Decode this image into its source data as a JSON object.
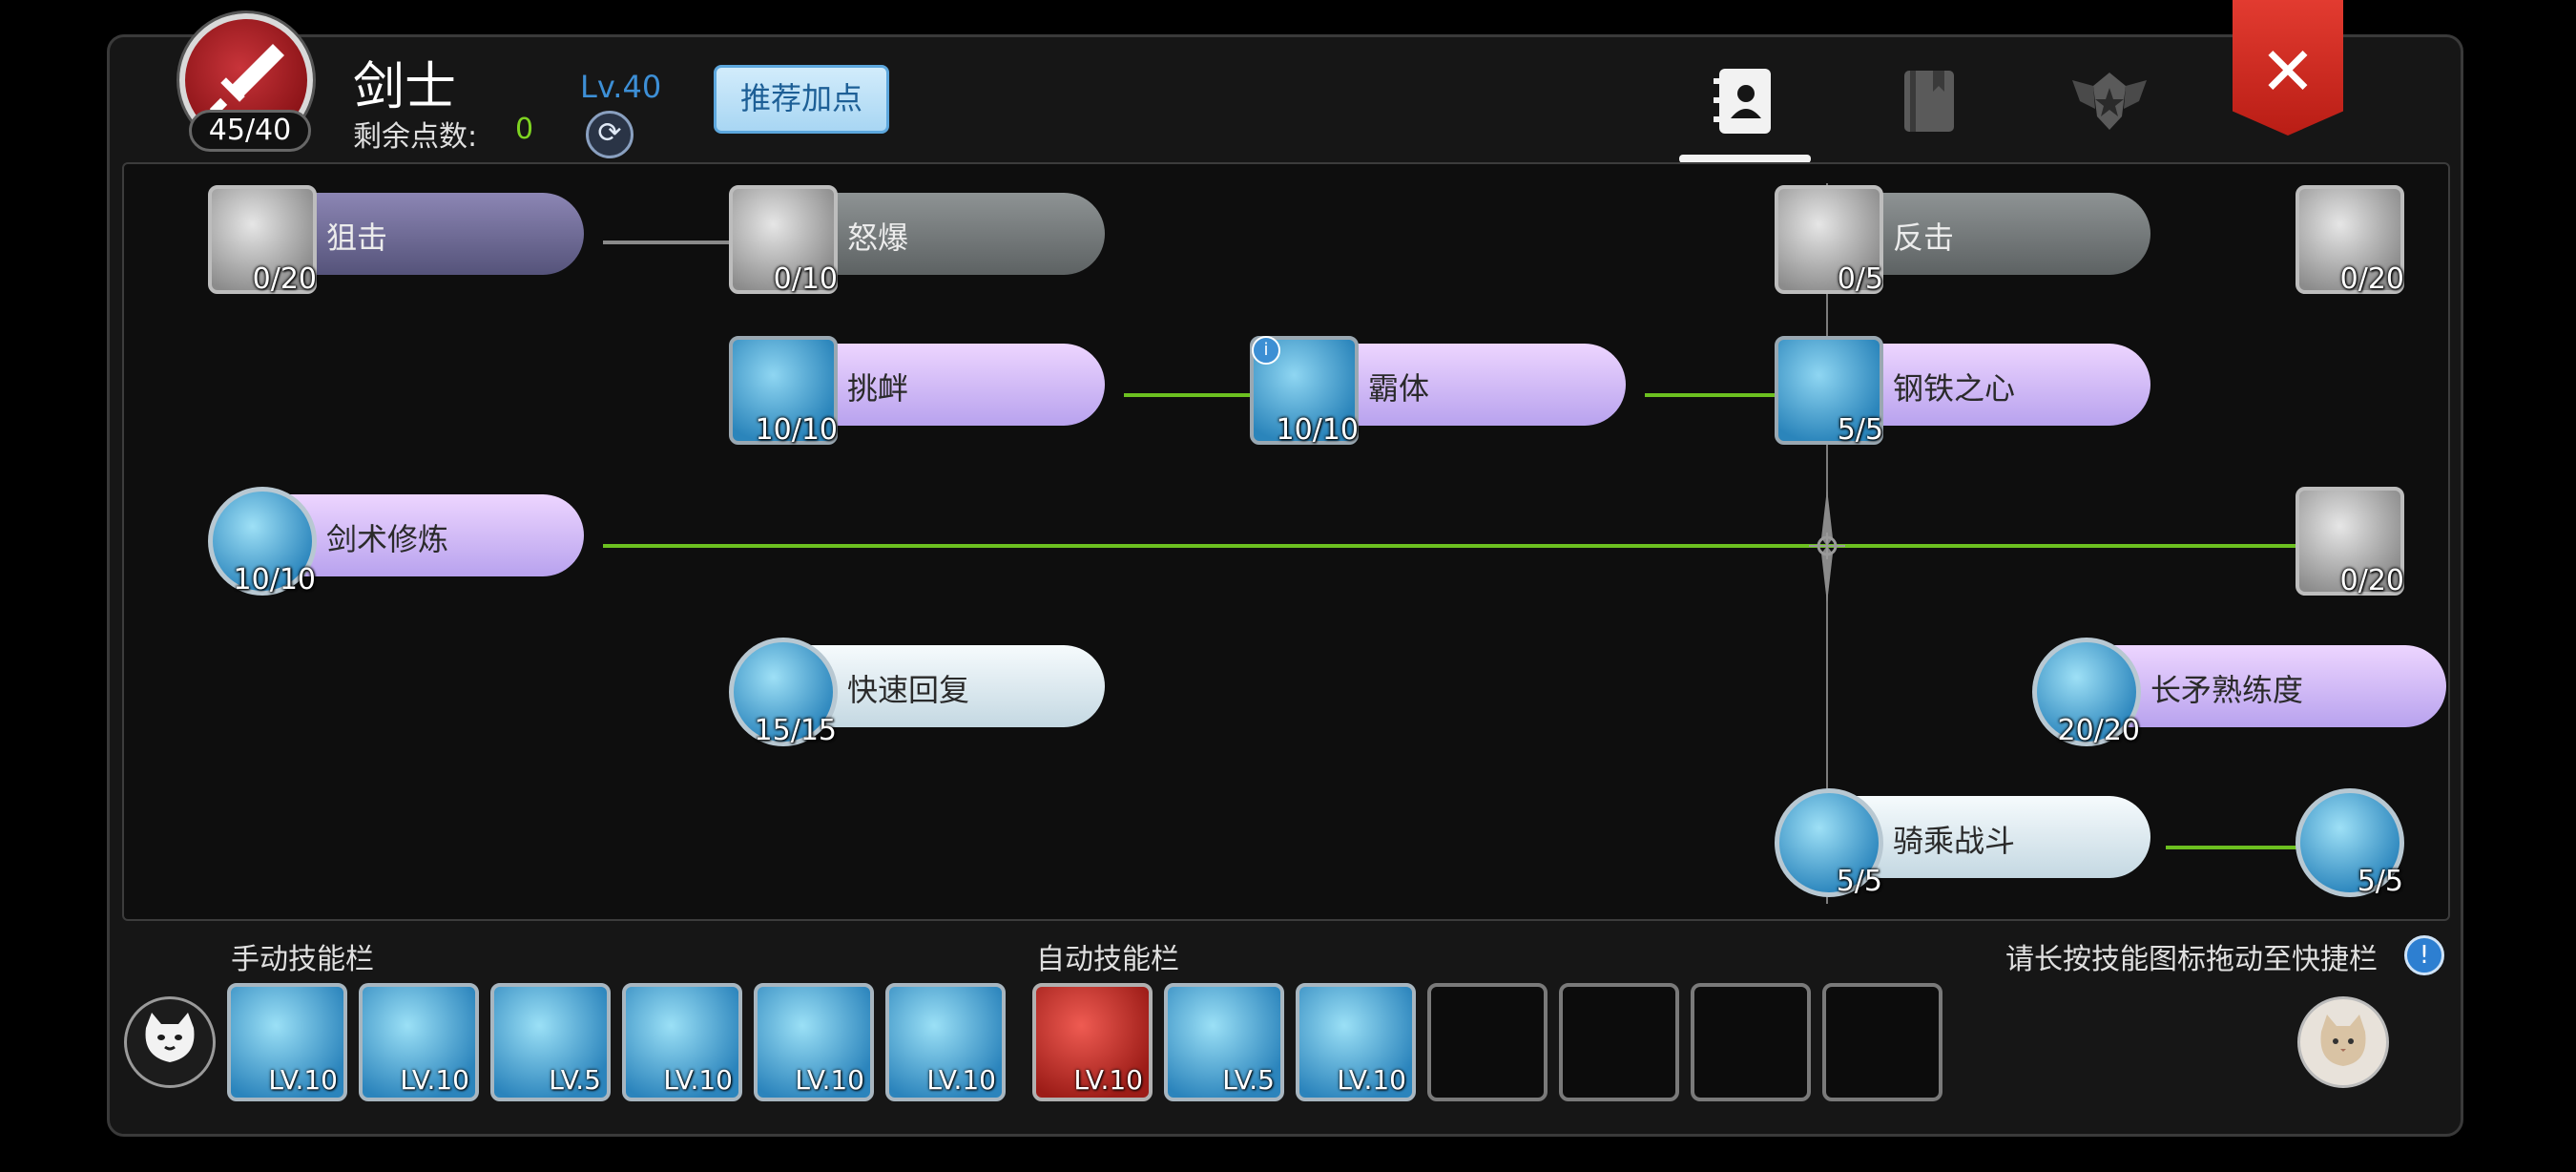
{
  "header": {
    "job_name": "剑士",
    "points_badge": "45/40",
    "remaining_label": "剩余点数:",
    "remaining_value": "0",
    "level": "Lv.40",
    "recommend_button": "推荐加点",
    "close_symbol": "✕"
  },
  "tabs": [
    {
      "icon": "contact-book-icon",
      "active": true
    },
    {
      "icon": "book-icon",
      "active": false
    },
    {
      "icon": "winged-emblem-icon",
      "active": false
    }
  ],
  "skills": [
    {
      "name": "狙击",
      "level": "0/20",
      "learned": false
    },
    {
      "name": "怒爆",
      "level": "0/10",
      "learned": false
    },
    {
      "name": "反击",
      "level": "0/5",
      "learned": false
    },
    {
      "name": "",
      "level": "0/20",
      "learned": false
    },
    {
      "name": "挑衅",
      "level": "10/10",
      "learned": true
    },
    {
      "name": "霸体",
      "level": "10/10",
      "learned": true
    },
    {
      "name": "钢铁之心",
      "level": "5/5",
      "learned": true
    },
    {
      "name": "剑术修炼",
      "level": "10/10",
      "learned": true
    },
    {
      "name": "",
      "level": "0/20",
      "learned": false
    },
    {
      "name": "快速回复",
      "level": "15/15",
      "learned": true
    },
    {
      "name": "长矛熟练度",
      "level": "20/20",
      "learned": true
    },
    {
      "name": "骑乘战斗",
      "level": "5/5",
      "learned": true
    },
    {
      "name": "",
      "level": "5/5",
      "learned": true
    }
  ],
  "hotbar": {
    "manual_label": "手动技能栏",
    "auto_label": "自动技能栏",
    "hint": "请长按技能图标拖动至快捷栏",
    "hint_icon": "!",
    "manual_slots": [
      "LV.10",
      "LV.10",
      "LV.5",
      "LV.10",
      "LV.10",
      "LV.10"
    ],
    "auto_slots": [
      "LV.10",
      "LV.5",
      "LV.10",
      "",
      "",
      "",
      ""
    ]
  },
  "colors": {
    "learned_line": "#6cc020",
    "level_text": "#3d8fd6",
    "remaining_value": "#7ed321",
    "close_red": "#d32f26"
  }
}
